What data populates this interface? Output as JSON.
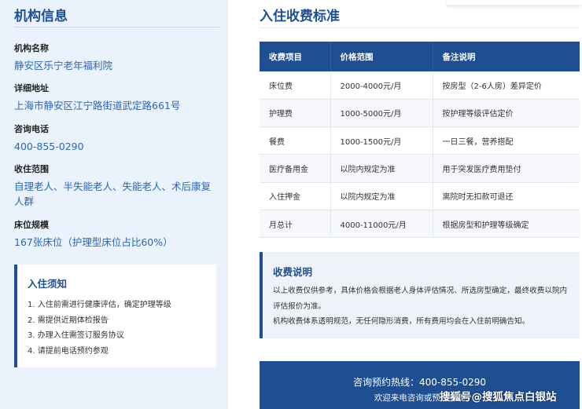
{
  "org": {
    "title": "机构信息",
    "fields": [
      {
        "label": "机构名称",
        "value": "静安区乐宁老年福利院"
      },
      {
        "label": "详细地址",
        "value": "上海市静安区江宁路街道武定路661号"
      },
      {
        "label": "咨询电话",
        "value": "400-855-0290"
      },
      {
        "label": "收住范围",
        "value": "自理老人、半失能老人、失能老人、术后康复人群"
      },
      {
        "label": "床位规模",
        "value": "167张床位（护理型床位占比60%）"
      }
    ]
  },
  "notice": {
    "title": "入住须知",
    "items": [
      "1. 入住前需进行健康评估，确定护理等级",
      "2. 需提供近期体检报告",
      "3. 办理入住需签订服务协议",
      "4. 请提前电话预约参观"
    ]
  },
  "fees": {
    "title": "入住收费标准",
    "headers": [
      "收费项目",
      "价格范围",
      "备注说明"
    ],
    "rows": [
      [
        "床位费",
        "2000-4000元/月",
        "按房型（2-6人房）差异定价"
      ],
      [
        "护理费",
        "1000-5000元/月",
        "按护理等级评估定价"
      ],
      [
        "餐费",
        "1000-1500元/月",
        "一日三餐，营养搭配"
      ],
      [
        "医疗备用金",
        "以院内规定为准",
        "用于突发医疗费用垫付"
      ],
      [
        "入住押金",
        "以院内规定为准",
        "离院时无扣款可退还"
      ],
      [
        "月总计",
        "4000-11000元/月",
        "根据房型和护理等级确定"
      ]
    ]
  },
  "explain": {
    "title": "收费说明",
    "line1": "以上收费仅供参考，具体价格会根据老人身体评估情况、所选房型确定，最终收费以院内评估报价为准。",
    "line2": "机构收费体系透明规范，无任何隐形消费，所有费用均会在入住前明确告知。"
  },
  "hotline": {
    "line1": "咨询预约热线：400-855-0290",
    "line2": "欢迎来电咨询或预约参观"
  },
  "watermark": "搜狐号@搜狐焦点白银站",
  "colors": {
    "brand": "#1f4f93",
    "link": "#2d66b5",
    "panel": "#eaf2fb"
  }
}
